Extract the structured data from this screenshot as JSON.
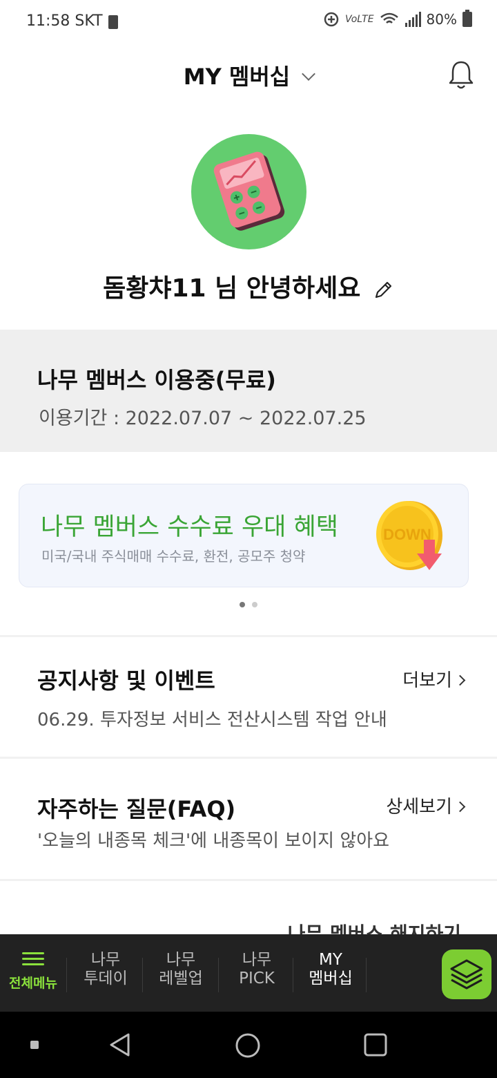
{
  "status_bar": {
    "time": "11:58 SKT",
    "network": "VoLTE",
    "battery": "80%"
  },
  "header": {
    "title": "MY 멤버십",
    "icons": [
      "chevron-down-icon",
      "bell-icon"
    ]
  },
  "profile": {
    "greeting": "돔황챠11 님 안녕하세요",
    "avatar_icon": "calculator-chart-icon",
    "edit_icon": "pencil-icon"
  },
  "membership": {
    "title": "나무 멤버스 이용중(무료)",
    "period": "이용기간 : 2022.07.07 ~ 2022.07.25"
  },
  "banner": {
    "title": "나무 멤버스 수수료 우대 혜택",
    "subtitle": "미국/국내 주식매매 수수료, 환전, 공모주 청약",
    "coin_text": "DOWN",
    "page_count": 2,
    "active_page": 1
  },
  "notices": {
    "title": "공지사항 및 이벤트",
    "more": "더보기",
    "item": "06.29. 투자정보 서비스 전산시스템 작업 안내"
  },
  "faq": {
    "title": "자주하는 질문(FAQ)",
    "more": "상세보기",
    "item": "'오늘의 내종목 체크'에 내종목이 보이지 않아요"
  },
  "cancel_link": "나무 멤버스 해지하기",
  "bottom_nav": {
    "menu": "전체메뉴",
    "items": [
      {
        "line1": "나무",
        "line2": "투데이"
      },
      {
        "line1": "나무",
        "line2": "레벨업"
      },
      {
        "line1": "나무",
        "line2": "PICK"
      },
      {
        "line1": "MY",
        "line2": "멤버십"
      }
    ]
  },
  "colors": {
    "accent_green": "#3aa535",
    "nav_green": "#8be13c",
    "avatar_bg": "#63cd6f"
  }
}
